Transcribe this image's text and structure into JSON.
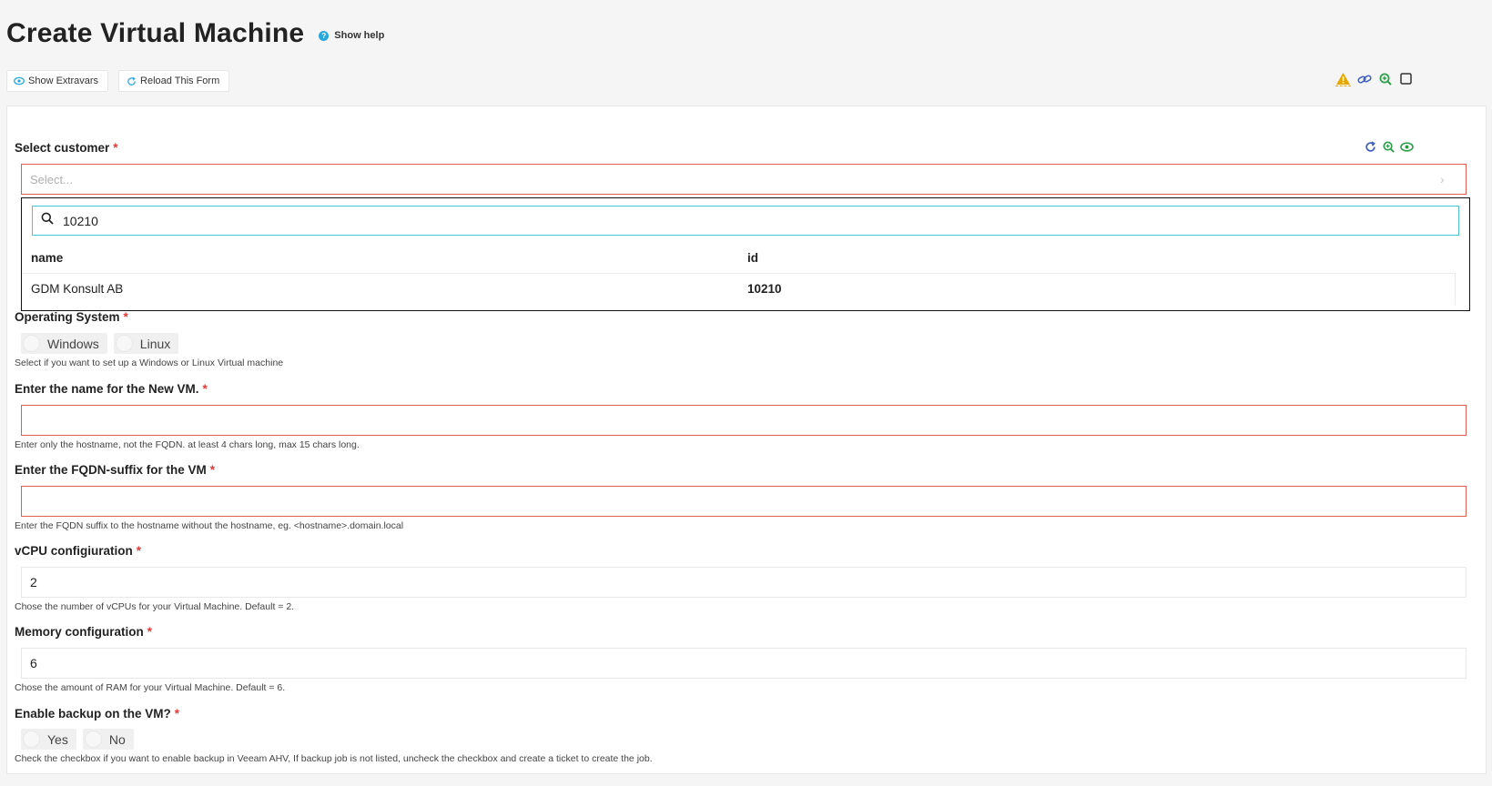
{
  "page": {
    "title": "Create Virtual Machine",
    "help_label": "Show help",
    "help_glyph": "?"
  },
  "toolbar": {
    "show_extravars": "Show Extravars",
    "reload_form": "Reload This Form"
  },
  "icons": {
    "warning": "warning-icon",
    "link": "link-icon",
    "zoom": "zoom-in-icon",
    "square": "checkbox-icon",
    "refresh": "refresh-icon",
    "eye": "eye-icon",
    "search": "search-icon",
    "chevron": "chevron-right-icon"
  },
  "colors": {
    "required": "#e53935",
    "invalid_border": "#e35d4f",
    "accent_cyan": "#4dc1d6",
    "help_blue": "#29a8e0",
    "warning": "#e6a800",
    "link_blue": "#3f5fbf",
    "zoom_green": "#2e9e4a"
  },
  "form": {
    "customer": {
      "label": "Select customer",
      "required_mark": "*",
      "placeholder": "Select...",
      "chevron": "›",
      "dropdown": {
        "search_value": "10210",
        "columns": [
          "name",
          "id"
        ],
        "rows": [
          {
            "name": "GDM Konsult AB",
            "id": "10210"
          }
        ]
      }
    },
    "os": {
      "label": "Operating System",
      "required_mark": "*",
      "options": [
        "Windows",
        "Linux"
      ],
      "help": "Select if you want to set up a Windows or Linux Virtual machine"
    },
    "vm_name": {
      "label": "Enter the name for the New VM.",
      "required_mark": "*",
      "value": "",
      "help": "Enter only the hostname, not the FQDN. at least 4 chars long, max 15 chars long."
    },
    "fqdn": {
      "label": "Enter the FQDN-suffix for the VM",
      "required_mark": "*",
      "value": "",
      "help": "Enter the FQDN suffix to the hostname without the hostname, eg. <hostname>.domain.local"
    },
    "vcpu": {
      "label": "vCPU configiuration",
      "required_mark": "*",
      "value": "2",
      "help": "Chose the number of vCPUs for your Virtual Machine. Default = 2."
    },
    "memory": {
      "label": "Memory configuration",
      "required_mark": "*",
      "value": "6",
      "help": "Chose the amount of RAM for your Virtual Machine. Default = 6."
    },
    "backup": {
      "label": "Enable backup on the VM?",
      "required_mark": "*",
      "options": [
        "Yes",
        "No"
      ],
      "help": "Check the checkbox if you want to enable backup in Veeam AHV, If backup job is not listed, uncheck the checkbox and create a ticket to create the job."
    }
  }
}
